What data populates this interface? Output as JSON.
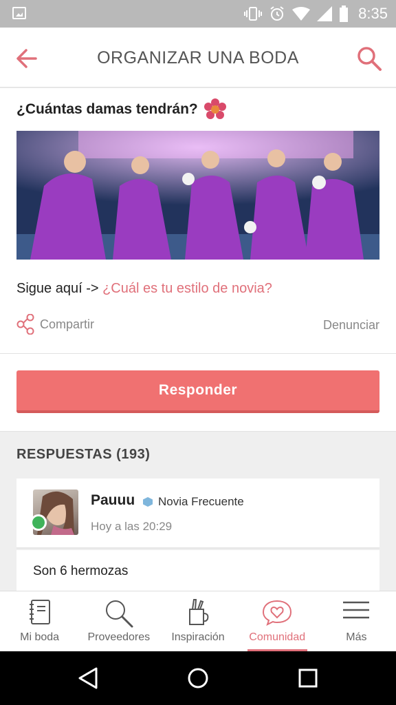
{
  "status_bar": {
    "time": "8:35"
  },
  "app_bar": {
    "title": "ORGANIZAR UNA BODA",
    "back_icon": "arrow-left-icon",
    "search_icon": "search-icon"
  },
  "post": {
    "title": "¿Cuántas damas tendrán?",
    "text_prefix": "Sigue aquí -> ",
    "link_text": "¿Cuál es tu estilo de novia?",
    "share_label": "Compartir",
    "report_label": "Denunciar"
  },
  "respond_button": "Responder",
  "replies": {
    "header": "RESPUESTAS (193)",
    "items": [
      {
        "author": "Pauuu",
        "badge": "Novia Frecuente",
        "time": "Hoy a las 20:29",
        "body": "Son 6 hermozas"
      }
    ]
  },
  "bottom_nav": [
    {
      "label": "Mi boda",
      "icon": "notebook-icon"
    },
    {
      "label": "Proveedores",
      "icon": "search-icon"
    },
    {
      "label": "Inspiración",
      "icon": "pencil-cup-icon"
    },
    {
      "label": "Comunidad",
      "icon": "heart-chat-icon",
      "active": true
    },
    {
      "label": "Más",
      "icon": "menu-icon"
    }
  ],
  "colors": {
    "accent": "#e0707a",
    "button": "#f07171",
    "status_bar": "#b9b9b9"
  }
}
